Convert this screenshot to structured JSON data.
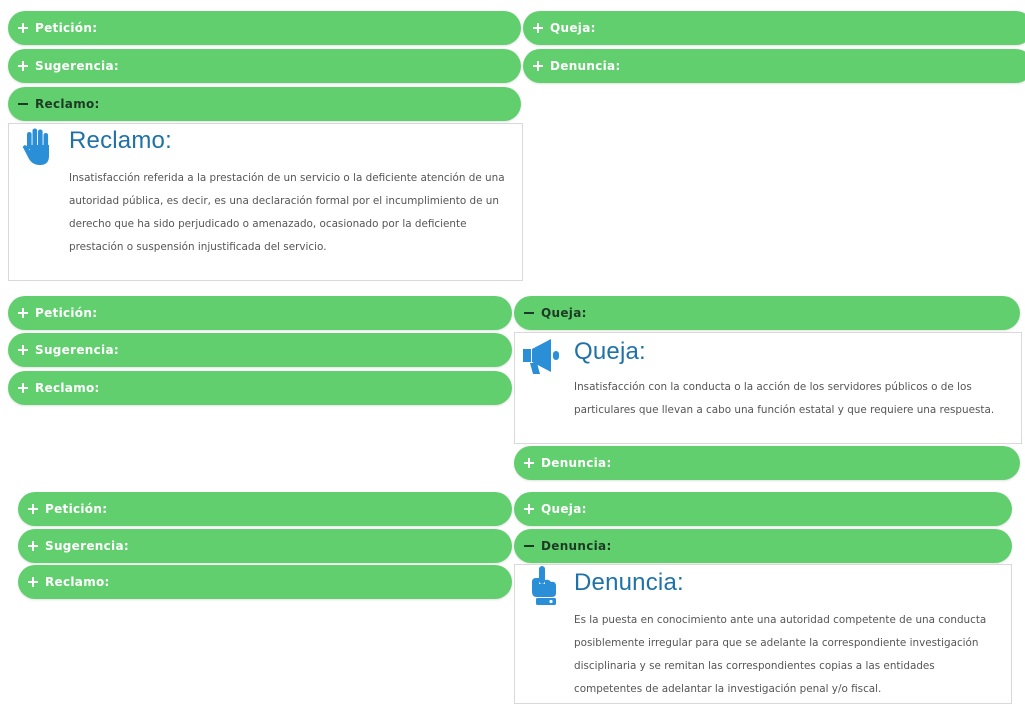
{
  "labels": {
    "peticion": "Petición:",
    "queja": "Queja:",
    "sugerencia": "Sugerencia:",
    "denuncia": "Denuncia:",
    "reclamo": "Reclamo:"
  },
  "panels": {
    "reclamo": {
      "icon": "hand-stop-icon",
      "title": "Reclamo:",
      "text": "Insatisfacción referida a la prestación de un servicio o la deficiente atención de una autoridad pública, es decir, es una declaración formal por el incumplimiento de un derecho que ha sido perjudicado o amenazado, ocasionado por la deficiente prestación o suspensión injustificada del servicio."
    },
    "queja": {
      "icon": "megaphone-icon",
      "title": "Queja:",
      "text": "Insatisfacción con la conducta o la acción de los servidores públicos o de los particulares que llevan a cabo una función estatal y que requiere una respuesta."
    },
    "denuncia": {
      "icon": "pointing-hand-icon",
      "title": "Denuncia:",
      "text": "Es la puesta en conocimiento ante una autoridad competente de una conducta posiblemente irregular para que se adelante la correspondiente investigación disciplinaria y se remitan las correspondientes copias a las entidades competentes de adelantar la investigación penal y/o fiscal."
    }
  },
  "colors": {
    "accordion": "#62cf6f",
    "title": "#1f72a8",
    "icon": "#2a8fd6",
    "text": "#555555"
  }
}
